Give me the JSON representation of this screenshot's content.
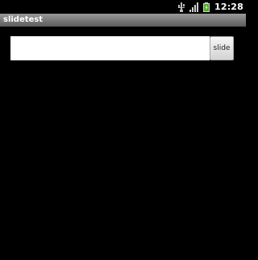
{
  "status_bar": {
    "time": "12:28",
    "icons": [
      "usb-icon",
      "signal-icon",
      "battery-icon"
    ],
    "battery_color": "#4caf1c"
  },
  "app": {
    "title": "slidetest"
  },
  "form": {
    "input_value": "",
    "button_label": "slide"
  }
}
